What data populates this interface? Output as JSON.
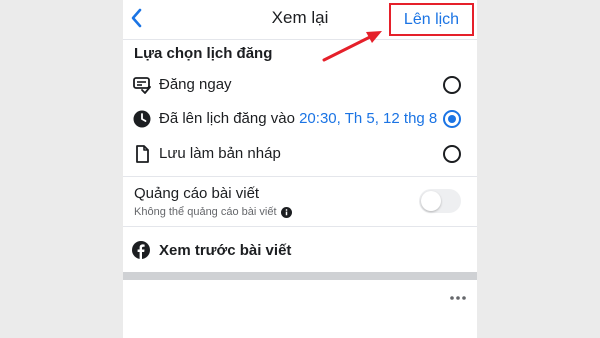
{
  "header": {
    "title": "Xem lại",
    "schedule_button": "Lên lịch"
  },
  "publish_options": {
    "title": "Lựa chọn lịch đăng",
    "options": [
      {
        "label": "Đăng ngay",
        "icon": "post-now-icon",
        "selected": false
      },
      {
        "label": "Đã lên lịch đăng vào ",
        "time": "20:30, Th 5, 12 thg 8",
        "icon": "clock-icon",
        "selected": true
      },
      {
        "label": "Lưu làm bản nháp",
        "icon": "draft-document-icon",
        "selected": false
      }
    ]
  },
  "boost": {
    "title": "Quảng cáo bài viết",
    "subtitle": "Không thể quảng cáo bài viết",
    "enabled": false
  },
  "preview": {
    "label": "Xem trước bài viết",
    "icon": "facebook-icon"
  },
  "colors": {
    "accent": "#1b74e4",
    "annotation_red": "#e5202a",
    "text": "#1c1e21",
    "muted": "#65676b"
  }
}
